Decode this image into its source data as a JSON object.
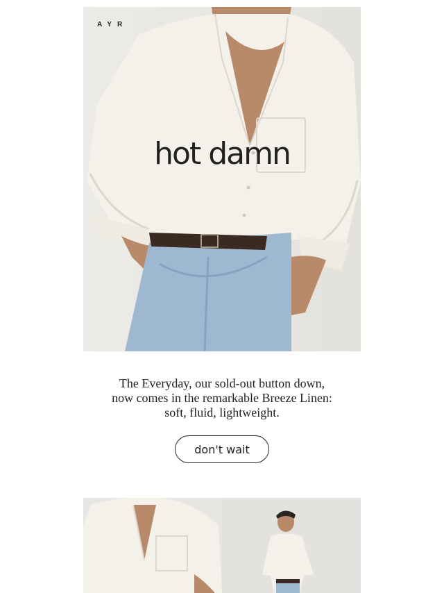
{
  "brand": {
    "logo_text": "AYR",
    "logo_icon": "ayr-wordmark"
  },
  "hero": {
    "title": "hot damn",
    "image_alt": "model-wearing-white-linen-button-down-and-light-jeans"
  },
  "copy": {
    "line1": "The Everyday, our sold-out button down,",
    "line2": "now comes in the remarkable Breeze Linen:",
    "line3": "soft, fluid, lightweight."
  },
  "cta": {
    "label": "don't wait"
  },
  "tiles": [
    {
      "image_alt": "close-up-shirt-detail"
    },
    {
      "image_alt": "full-body-model-in-shirt"
    }
  ],
  "colors": {
    "text": "#222222",
    "background": "#ffffff",
    "shirt": "#f4f1ea",
    "denim": "#9fb8d1",
    "skin": "#b98a6a"
  }
}
